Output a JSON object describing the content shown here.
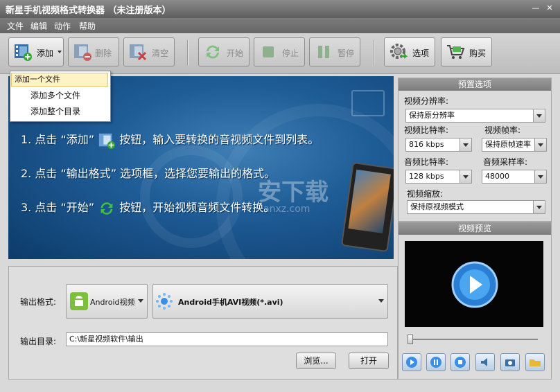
{
  "window": {
    "title": "新星手机视频格式转换器 （未注册版本）"
  },
  "menu": [
    "文件",
    "编辑",
    "动作",
    "帮助"
  ],
  "toolbar": {
    "add": "添加",
    "delete": "删除",
    "clear": "清空",
    "start": "开始",
    "stop": "停止",
    "pause": "暂停",
    "options": "选项",
    "buy": "购买"
  },
  "add_menu": [
    "添加一个文件",
    "添加多个文件",
    "添加整个目录"
  ],
  "banner": {
    "line1_a": "1. 点击 “添加”",
    "line1_b": "按钮，输入要转换的音视频文件到列表。",
    "line2": "2. 点击 “输出格式” 选项框，选择您要输出的格式。",
    "line3_a": "3. 点击 “开始”",
    "line3_b": "按钮，开始视频音频文件转换。",
    "watermark": "安下载",
    "watermark_sub": "anxz.com"
  },
  "output": {
    "format_label": "输出格式:",
    "category": "Android视频",
    "format": "Android手机AVI视频(*.avi)",
    "dir_label": "输出目录:",
    "dir": "C:\\新星视频软件\\输出",
    "browse": "浏览...",
    "open": "打开"
  },
  "preset": {
    "title": "预置选项",
    "resolution_label": "视频分辨率:",
    "resolution": "保持原分辨率",
    "vbitrate_label": "视频比特率:",
    "vbitrate": "816 kbps",
    "fps_label": "视频帧率:",
    "fps": "保持原帧速率",
    "abitrate_label": "音频比特率:",
    "abitrate": "128 kbps",
    "samplerate_label": "音频采样率:",
    "samplerate": "48000",
    "scale_label": "视频缩放:",
    "scale": "保持原视频模式"
  },
  "preview": {
    "title": "视频预览"
  },
  "colors": {
    "banner": "#1f5d97",
    "titlebar": "#6b6b6b",
    "accent": "#3a8ee6"
  }
}
